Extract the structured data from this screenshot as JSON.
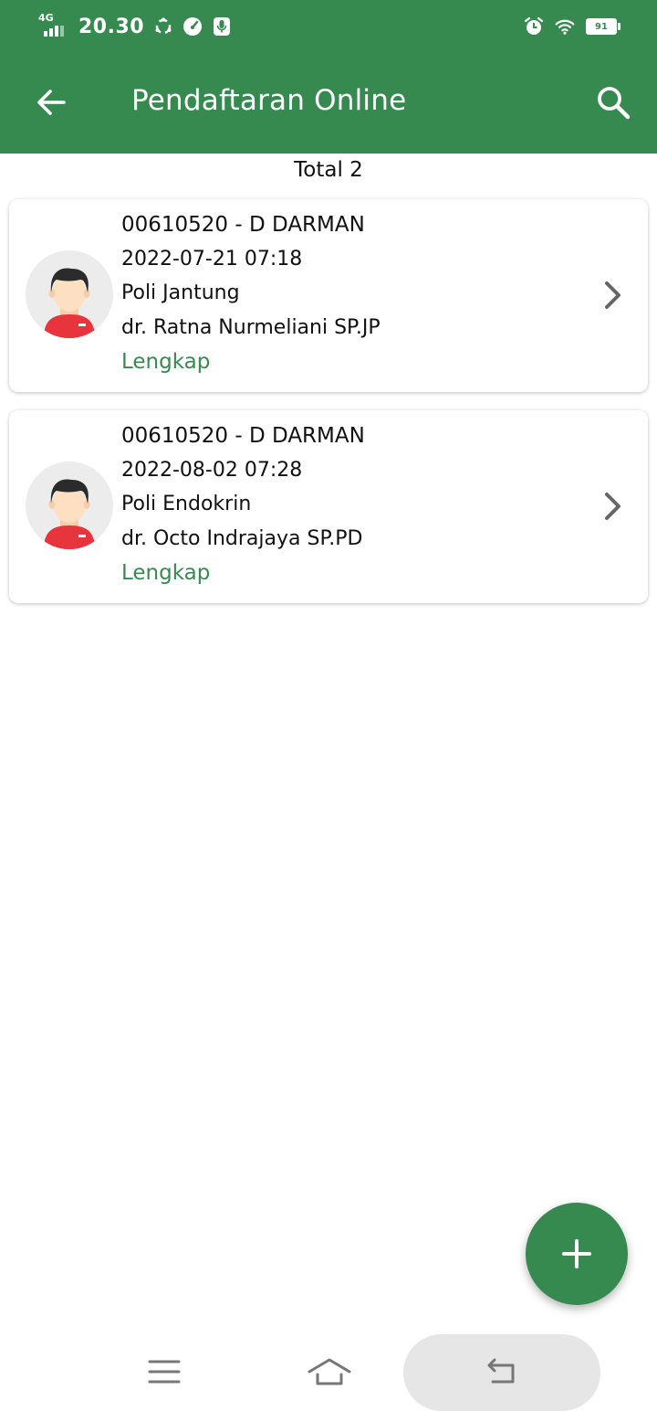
{
  "status_bar": {
    "network": "4G",
    "time": "20.30",
    "battery": "91",
    "icons": [
      "signal-icon",
      "sync-icon",
      "speedometer-icon",
      "mic-icon",
      "alarm-icon",
      "wifi-icon",
      "battery-icon"
    ]
  },
  "app_bar": {
    "title": "Pendaftaran Online",
    "back_icon": "arrow-left-icon",
    "search_icon": "search-icon"
  },
  "total_label": "Total 2",
  "registrations": [
    {
      "id_name": "00610520 - D DARMAN",
      "datetime": "2022-07-21 07:18",
      "clinic": "Poli Jantung",
      "doctor": "dr. Ratna Nurmeliani SP.JP",
      "status": "Lengkap"
    },
    {
      "id_name": "00610520 - D DARMAN",
      "datetime": "2022-08-02 07:28",
      "clinic": "Poli Endokrin",
      "doctor": "dr. Octo Indrajaya SP.PD",
      "status": "Lengkap"
    }
  ],
  "fab_icon": "plus-icon",
  "nav_bar": {
    "items": [
      "menu-icon",
      "home-icon",
      "back-icon"
    ]
  },
  "colors": {
    "primary": "#368a4f",
    "status_text": "#368a4f",
    "avatar_shirt": "#e8343d",
    "avatar_hair": "#2b2b2b",
    "avatar_skin": "#fde0c2"
  }
}
